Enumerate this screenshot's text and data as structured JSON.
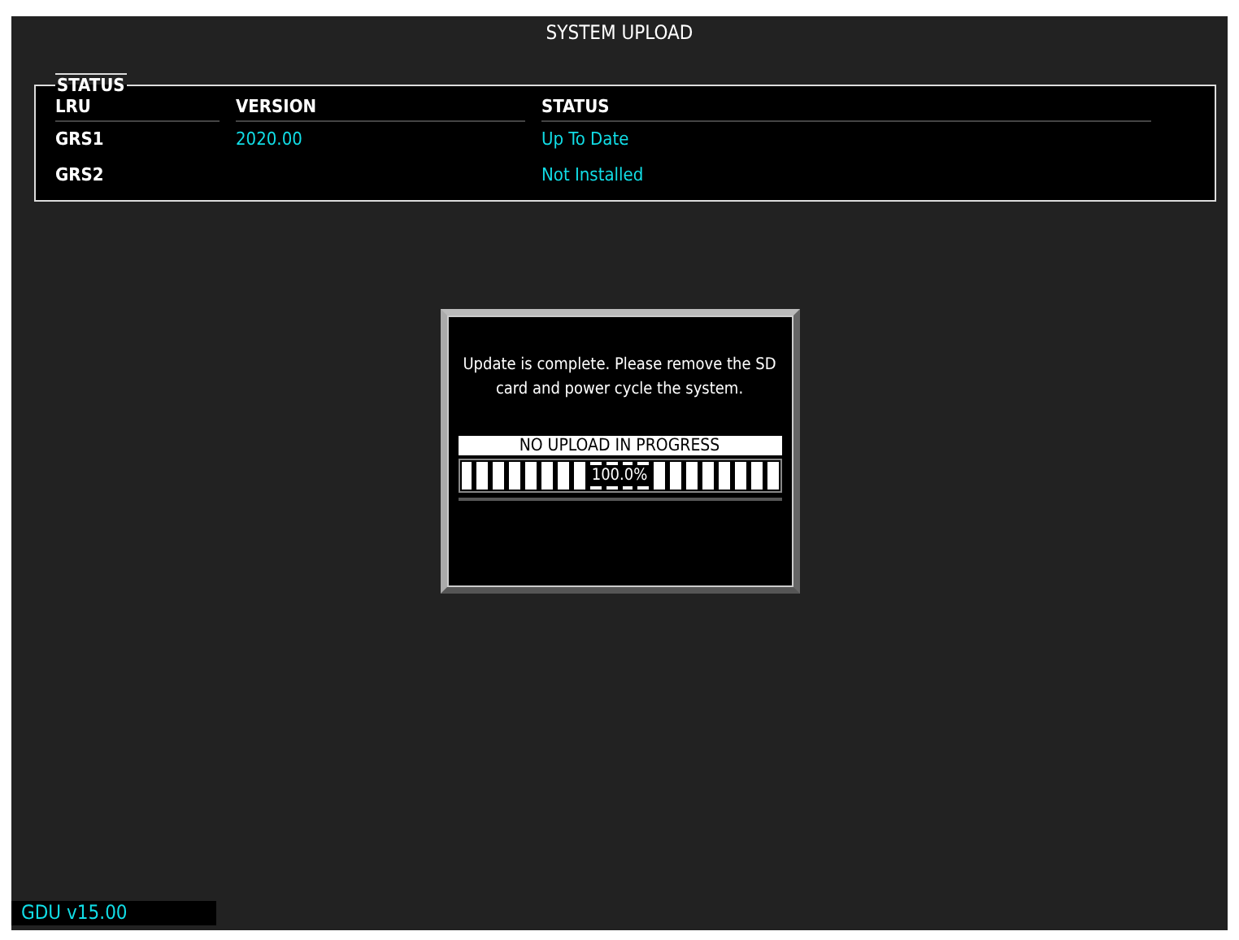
{
  "title": "SYSTEM UPLOAD",
  "status_panel": {
    "legend": "STATUS",
    "columns": [
      "LRU",
      "VERSION",
      "STATUS"
    ],
    "rows": [
      {
        "lru": "GRS1",
        "version": "2020.00",
        "status": "Up To Date"
      },
      {
        "lru": "GRS2",
        "status": "Not Installed"
      }
    ]
  },
  "dialog": {
    "message": "Update is complete. Please remove the SD card and power cycle the system.",
    "progress_label": "NO UPLOAD IN PROGRESS",
    "progress": {
      "level": 1,
      "reading": "100.0%"
    }
  },
  "footer": {
    "version": "GDU v15.00"
  }
}
